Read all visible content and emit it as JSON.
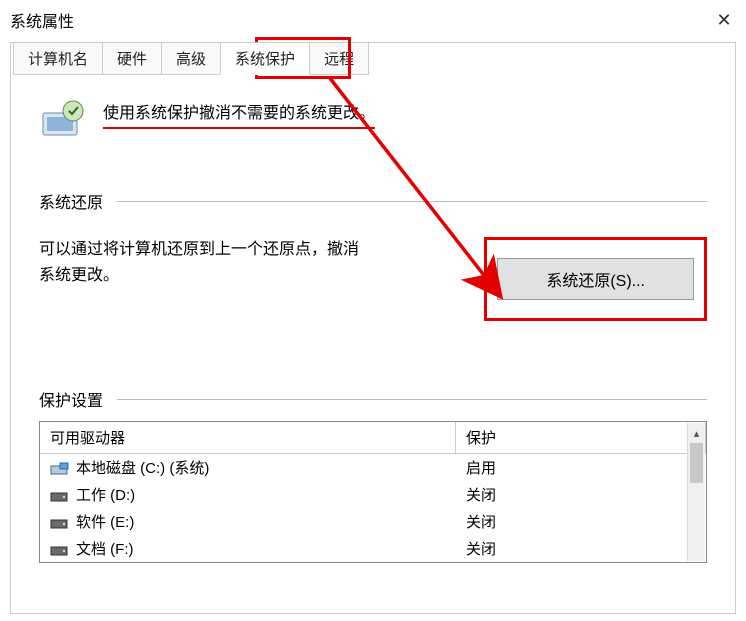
{
  "window": {
    "title": "系统属性"
  },
  "tabs": {
    "computer_name": "计算机名",
    "hardware": "硬件",
    "advanced": "高级",
    "system_protection": "系统保护",
    "remote": "远程"
  },
  "description": "使用系统保护撤消不需要的系统更改。",
  "sections": {
    "system_restore_title": "系统还原",
    "restore_desc": "可以通过将计算机还原到上一个还原点，撤消系统更改。",
    "restore_button": "系统还原(S)...",
    "protection_title": "保护设置"
  },
  "drives": {
    "header_drive": "可用驱动器",
    "header_protect": "保护",
    "rows": [
      {
        "name": "本地磁盘 (C:) (系统)",
        "status": "启用",
        "sys": true
      },
      {
        "name": "工作 (D:)",
        "status": "关闭",
        "sys": false
      },
      {
        "name": "软件 (E:)",
        "status": "关闭",
        "sys": false
      },
      {
        "name": "文档 (F:)",
        "status": "关闭",
        "sys": false
      }
    ]
  }
}
